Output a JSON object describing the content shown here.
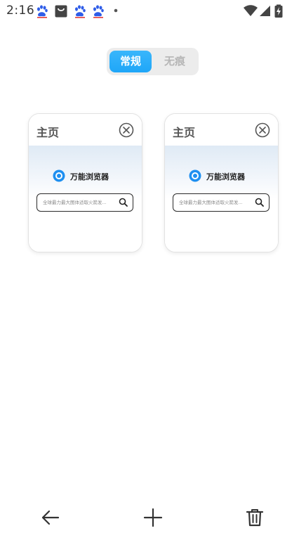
{
  "status_bar": {
    "time": "2:16",
    "notification_icons": [
      "baidu-paw-icon",
      "shopping-bag-icon",
      "baidu-paw-icon",
      "baidu-paw-icon",
      "dot-icon"
    ],
    "right_icons": [
      "wifi-icon",
      "cell-signal-icon",
      "battery-charging-icon"
    ]
  },
  "mode_switch": {
    "normal_label": "常规",
    "incognito_label": "无痕",
    "active": "normal",
    "accent_color": "#2aaef9"
  },
  "tabs": [
    {
      "title": "主页",
      "brand": "万能浏览器",
      "search_placeholder": "全球最力最大图体适取火箭发..."
    },
    {
      "title": "主页",
      "brand": "万能浏览器",
      "search_placeholder": "全球最力最大图体适取火箭发..."
    }
  ],
  "bottom_bar": {
    "icons": [
      "back-arrow-icon",
      "plus-icon",
      "trash-icon"
    ]
  }
}
